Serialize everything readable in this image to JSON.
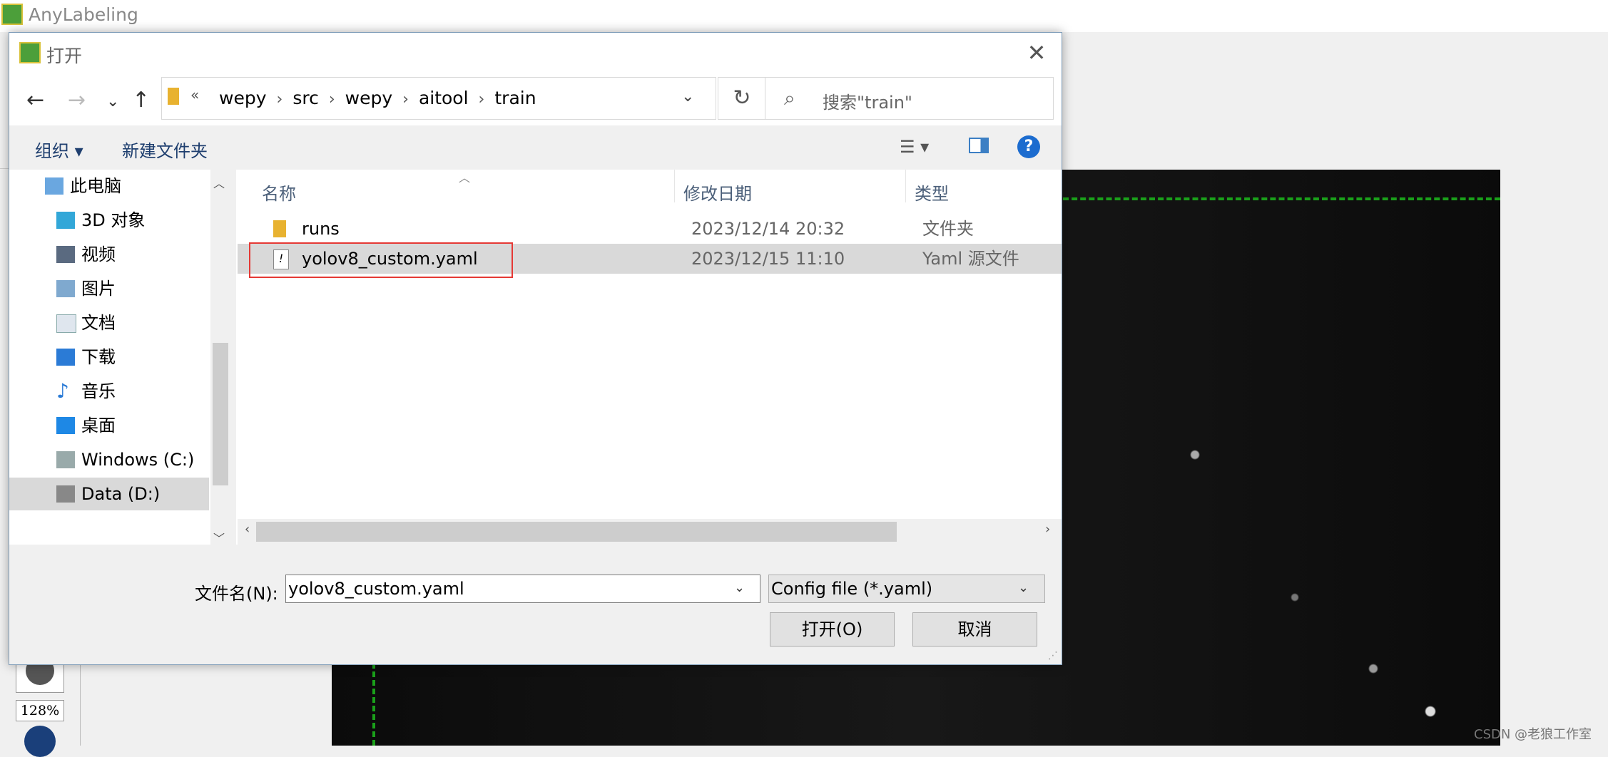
{
  "app": {
    "title": "AnyLabeling",
    "zoom": "128%",
    "watermark": "CSDN @老狼工作室"
  },
  "dialog": {
    "title": "打开",
    "close_glyph": "✕",
    "address": {
      "overflow": "«",
      "crumbs": [
        "wepy",
        "src",
        "wepy",
        "aitool",
        "train"
      ]
    },
    "search_placeholder": "搜索\"train\"",
    "toolbar": {
      "organize": "组织 ▾",
      "new_folder": "新建文件夹",
      "help": "?"
    },
    "nav_items": [
      {
        "label": "此电脑",
        "icon": "computer-icon"
      },
      {
        "label": "3D 对象",
        "icon": "3d-objects-icon"
      },
      {
        "label": "视频",
        "icon": "video-icon"
      },
      {
        "label": "图片",
        "icon": "pictures-icon"
      },
      {
        "label": "文档",
        "icon": "documents-icon"
      },
      {
        "label": "下载",
        "icon": "download-icon"
      },
      {
        "label": "音乐",
        "icon": "music-icon"
      },
      {
        "label": "桌面",
        "icon": "desktop-icon"
      },
      {
        "label": "Windows (C:)",
        "icon": "drive-c-icon"
      },
      {
        "label": "Data (D:)",
        "icon": "drive-d-icon",
        "selected": true
      }
    ],
    "columns": {
      "name": "名称",
      "modified": "修改日期",
      "type": "类型"
    },
    "files": [
      {
        "name": "runs",
        "modified": "2023/12/14 20:32",
        "type": "文件夹",
        "icon": "folder-icon"
      },
      {
        "name": "yolov8_custom.yaml",
        "modified": "2023/12/15 11:10",
        "type": "Yaml 源文件",
        "icon": "file-icon",
        "selected": true
      }
    ],
    "filename_label": "文件名(N):",
    "filename_value": "yolov8_custom.yaml",
    "filetype_value": "Config file (*.yaml)",
    "open_label": "打开(O)",
    "cancel_label": "取消"
  },
  "colors": {
    "accent": "#1c6ccf",
    "selection": "#d9d9d9",
    "highlight_outline": "#e53935",
    "annotation_line": "#1aa01a"
  }
}
